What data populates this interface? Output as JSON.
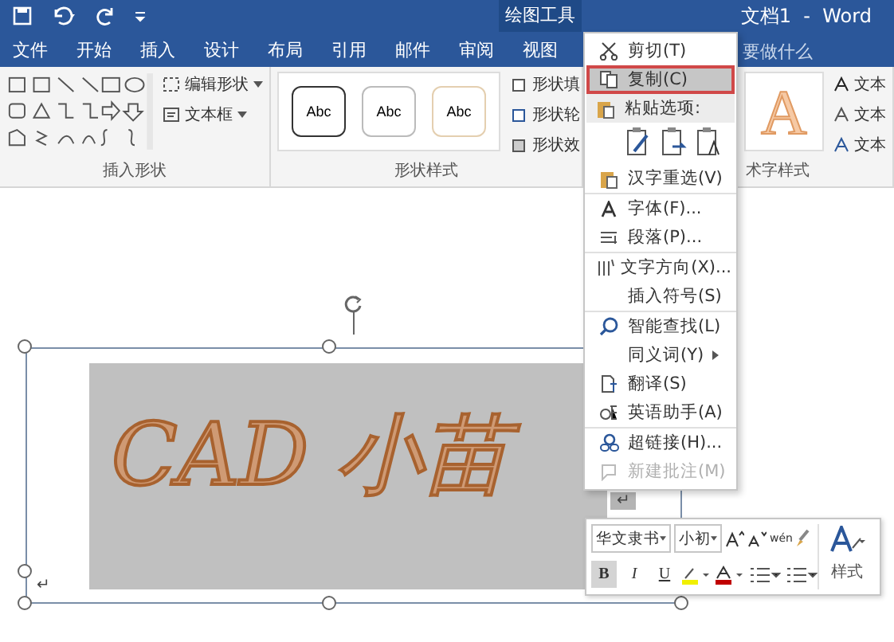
{
  "title_bar": {
    "contextual_tab": "绘图工具",
    "document_title": "文档1  -  Word"
  },
  "tabs": [
    {
      "label": "文件",
      "selected": false
    },
    {
      "label": "开始",
      "selected": false
    },
    {
      "label": "插入",
      "selected": false
    },
    {
      "label": "设计",
      "selected": false
    },
    {
      "label": "布局",
      "selected": false
    },
    {
      "label": "引用",
      "selected": false
    },
    {
      "label": "邮件",
      "selected": false
    },
    {
      "label": "审阅",
      "selected": false
    },
    {
      "label": "视图",
      "selected": false
    }
  ],
  "tell_me": "要做什么",
  "insert_shapes": {
    "buttons": [
      {
        "label": "编辑形状"
      },
      {
        "label": "文本框"
      }
    ],
    "group_label": "插入形状"
  },
  "shape_styles": {
    "swatches": [
      "Abc",
      "Abc",
      "Abc"
    ],
    "commands": [
      "形状填",
      "形状轮",
      "形状效"
    ],
    "group_label": "形状样式"
  },
  "wordart_styles": {
    "sample": "A",
    "commands": [
      "文本",
      "文本",
      "文本"
    ],
    "group_label": "术字样式"
  },
  "document": {
    "wordart_text": "CAD 小苗",
    "paragraph_mark": "↵",
    "end_mark": "↵"
  },
  "context_menu": [
    [
      {
        "kind": "item",
        "label": "剪切(T)",
        "selected": false,
        "disabled": false
      },
      {
        "kind": "item",
        "label": "复制(C)",
        "selected": true,
        "disabled": false
      },
      {
        "kind": "header",
        "label": "粘贴选项:"
      },
      {
        "kind": "paste_row"
      },
      {
        "kind": "item",
        "label": "汉字重选(V)",
        "selected": false,
        "disabled": false
      }
    ],
    [
      {
        "kind": "item",
        "label": "字体(F)...",
        "selected": false,
        "disabled": false
      },
      {
        "kind": "item",
        "label": "段落(P)...",
        "selected": false,
        "disabled": false
      }
    ],
    [
      {
        "kind": "item",
        "label": "文字方向(X)...",
        "selected": false,
        "disabled": false
      },
      {
        "kind": "item",
        "label": "插入符号(S)",
        "selected": false,
        "disabled": false
      }
    ],
    [
      {
        "kind": "item",
        "label": "智能查找(L)",
        "selected": false,
        "disabled": false
      },
      {
        "kind": "submenu",
        "label": "同义词(Y)",
        "selected": false,
        "disabled": false
      },
      {
        "kind": "item",
        "label": "翻译(S)",
        "selected": false,
        "disabled": false
      },
      {
        "kind": "item",
        "label": "英语助手(A)",
        "selected": false,
        "disabled": false
      }
    ],
    [
      {
        "kind": "item",
        "label": "超链接(H)...",
        "selected": false,
        "disabled": false
      },
      {
        "kind": "item",
        "label": "新建批注(M)",
        "selected": false,
        "disabled": true
      }
    ]
  ],
  "mini_toolbar": {
    "font": "华文隶书",
    "size": "小初",
    "phonetic": "wén",
    "styles_label": "样式",
    "bold": true,
    "italic_label": "I",
    "bold_label": "B",
    "underline_label": "U"
  }
}
